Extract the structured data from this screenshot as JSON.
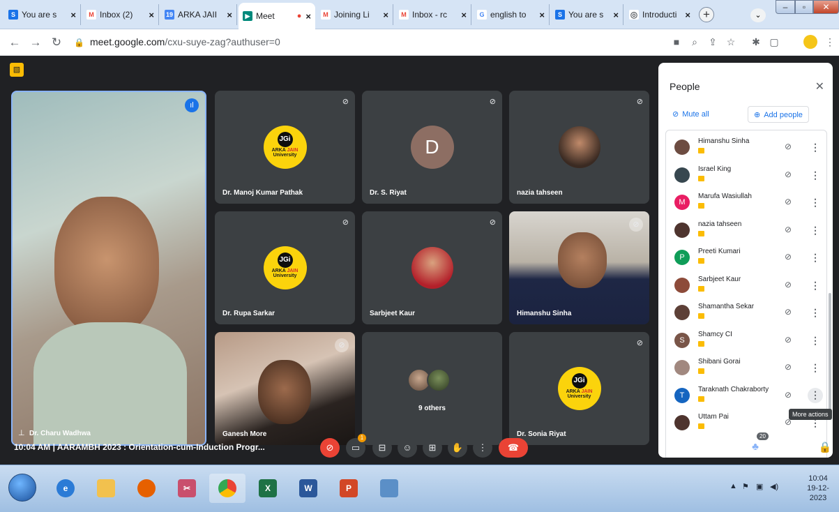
{
  "browser": {
    "tabs": [
      {
        "label": "You are s",
        "icon": "S",
        "color": "#1a73e8"
      },
      {
        "label": "Inbox (2)",
        "icon": "M",
        "color": "#ea4335"
      },
      {
        "label": "ARKA JAII",
        "icon": "19",
        "color": "#4285f4"
      },
      {
        "label": "Meet",
        "icon": "▶",
        "color": "#00897b",
        "active": true
      },
      {
        "label": "Joining Li",
        "icon": "M",
        "color": "#ea4335"
      },
      {
        "label": "Inbox - rc",
        "icon": "M",
        "color": "#ea4335"
      },
      {
        "label": "english to",
        "icon": "G",
        "color": "#4285f4"
      },
      {
        "label": "You are s",
        "icon": "S",
        "color": "#1a73e8"
      },
      {
        "label": "Introducti",
        "icon": "◎",
        "color": "#5f6368"
      }
    ],
    "url_host": "meet.google.com",
    "url_path": "/cxu-suye-zag?authuser=0"
  },
  "tiles": {
    "main": "Dr. Charu Wadhwa",
    "t1": "Dr. Manoj Kumar Pathak",
    "t2": "Dr. S. Riyat",
    "t2_letter": "D",
    "t3": "nazia tahseen",
    "t4": "Dr. Rupa Sarkar",
    "t5": "Sarbjeet Kaur",
    "t6": "Himanshu Sinha",
    "t7": "Ganesh More",
    "t8": "9 others",
    "t9": "Dr. Sonia Riyat",
    "logo_mark": "JGi",
    "logo_line1": "ARKA",
    "logo_line1b": "JAIN",
    "logo_line2": "University"
  },
  "people_panel": {
    "title": "People",
    "mute_all": "Mute all",
    "add_people": "Add people",
    "participants": [
      {
        "name": "Himanshu Sinha",
        "letter": "",
        "color": "#6d4c41"
      },
      {
        "name": "Israel King",
        "letter": "",
        "color": "#37474f"
      },
      {
        "name": "Marufa Wasiullah",
        "letter": "M",
        "color": "#e91e63"
      },
      {
        "name": "nazia tahseen",
        "letter": "",
        "color": "#4e342e"
      },
      {
        "name": "Preeti Kumari",
        "letter": "P",
        "color": "#0f9d58"
      },
      {
        "name": "Sarbjeet Kaur",
        "letter": "",
        "color": "#8d4b3a"
      },
      {
        "name": "Shamantha Sekar",
        "letter": "",
        "color": "#5d4037"
      },
      {
        "name": "Shamcy CI",
        "letter": "S",
        "color": "#795548"
      },
      {
        "name": "Shibani Gorai",
        "letter": "",
        "color": "#a1887f"
      },
      {
        "name": "Taraknath Chakraborty",
        "letter": "T",
        "color": "#1565c0"
      },
      {
        "name": "Uttam Pai",
        "letter": "",
        "color": "#4e342e"
      }
    ],
    "tooltip": "More actions"
  },
  "controls": {
    "meeting_info": "10:04 AM  |  AARAMBH 2023 : Orientation-cum-Induction Progr...",
    "people_count": "20",
    "notification_count": "1"
  },
  "taskbar": {
    "time": "10:04",
    "date": "19-12-2023"
  },
  "colors": {
    "meet_bg": "#202124",
    "tile_bg": "#3c4043",
    "accent_red": "#ea4335",
    "accent_blue": "#1a73e8",
    "brand_yellow": "#fbd30c"
  }
}
